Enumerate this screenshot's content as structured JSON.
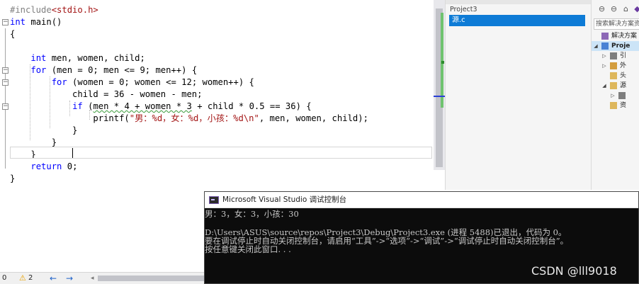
{
  "editor": {
    "lines": [
      {
        "parts": [
          {
            "c": "pp",
            "t": "#include"
          },
          {
            "c": "inc",
            "t": "<stdio.h>"
          }
        ]
      },
      {
        "parts": [
          {
            "c": "kw",
            "t": "int"
          },
          {
            "c": "",
            "t": " main()"
          }
        ]
      },
      {
        "parts": [
          {
            "c": "",
            "t": "{"
          }
        ]
      },
      {
        "parts": [
          {
            "c": "",
            "t": ""
          }
        ]
      },
      {
        "parts": [
          {
            "c": "",
            "t": "    "
          },
          {
            "c": "kw",
            "t": "int"
          },
          {
            "c": "",
            "t": " men, women, child;"
          }
        ]
      },
      {
        "parts": [
          {
            "c": "",
            "t": "    "
          },
          {
            "c": "kw",
            "t": "for"
          },
          {
            "c": "",
            "t": " (men = 0; men <= 9; men++) {"
          }
        ]
      },
      {
        "parts": [
          {
            "c": "",
            "t": "        "
          },
          {
            "c": "kw",
            "t": "for"
          },
          {
            "c": "",
            "t": " (women = 0; women <= 12; women++) {"
          }
        ]
      },
      {
        "parts": [
          {
            "c": "",
            "t": "            child = 36 - women - men;"
          }
        ]
      },
      {
        "parts": [
          {
            "c": "",
            "t": "            "
          },
          {
            "c": "kw",
            "t": "if"
          },
          {
            "c": "",
            "t": " ("
          },
          {
            "c": "squig",
            "t": "men * 4 + women * 3"
          },
          {
            "c": "",
            "t": " + child * 0.5 == 36) {"
          }
        ]
      },
      {
        "parts": [
          {
            "c": "",
            "t": "                printf("
          },
          {
            "c": "str",
            "t": "\"男：%d，女：%d，小孩：%d\\n\""
          },
          {
            "c": "",
            "t": ", men, women, child);"
          }
        ]
      },
      {
        "parts": [
          {
            "c": "",
            "t": "            }"
          }
        ]
      },
      {
        "parts": [
          {
            "c": "",
            "t": "        }"
          }
        ]
      },
      {
        "parts": [
          {
            "c": "",
            "t": "    }"
          }
        ]
      },
      {
        "parts": [
          {
            "c": "",
            "t": "    "
          },
          {
            "c": "kw",
            "t": "return"
          },
          {
            "c": "",
            "t": " 0;"
          }
        ]
      },
      {
        "parts": [
          {
            "c": "",
            "t": "}"
          }
        ]
      }
    ]
  },
  "solution_panel": {
    "project": "Project3",
    "selected_file": "源.c"
  },
  "solution_explorer": {
    "search_placeholder": "搜索解决方案资",
    "tree": [
      {
        "label": "解决方案",
        "arrow": "",
        "indent": 0,
        "selected": false,
        "icon": "solution-icon"
      },
      {
        "label": "Proje",
        "arrow": "◢",
        "indent": 0,
        "selected": true,
        "icon": "project-icon"
      },
      {
        "label": "引",
        "arrow": "▷",
        "indent": 1,
        "selected": false,
        "icon": "references-icon"
      },
      {
        "label": "外",
        "arrow": "▷",
        "indent": 1,
        "selected": false,
        "icon": "external-deps-icon"
      },
      {
        "label": "头",
        "arrow": "",
        "indent": 1,
        "selected": false,
        "icon": "folder-icon"
      },
      {
        "label": "源",
        "arrow": "◢",
        "indent": 1,
        "selected": false,
        "icon": "folder-icon"
      },
      {
        "label": "",
        "arrow": "▷",
        "indent": 2,
        "selected": false,
        "icon": "c-file-icon"
      },
      {
        "label": "资",
        "arrow": "",
        "indent": 1,
        "selected": false,
        "icon": "folder-icon"
      }
    ]
  },
  "status_bar": {
    "errors": "0",
    "warnings": "2"
  },
  "console": {
    "title": "Microsoft Visual Studio 调试控制台",
    "lines": [
      "男：3，女：3，小孩：30",
      "",
      "D:\\Users\\ASUS\\source\\repos\\Project3\\Debug\\Project3.exe (进程 5488)已退出，代码为 0。",
      "要在调试停止时自动关闭控制台，请启用“工具”->“选项”->“调试”->“调试停止时自动关闭控制台”。",
      "按任意键关闭此窗口. . ."
    ]
  },
  "watermark": "CSDN @lll9018",
  "colors": {
    "keyword": "#0000ff",
    "string": "#a31515",
    "preprocessor": "#808080",
    "selection": "#0e7bd6",
    "console_bg": "#0c0c0c"
  }
}
